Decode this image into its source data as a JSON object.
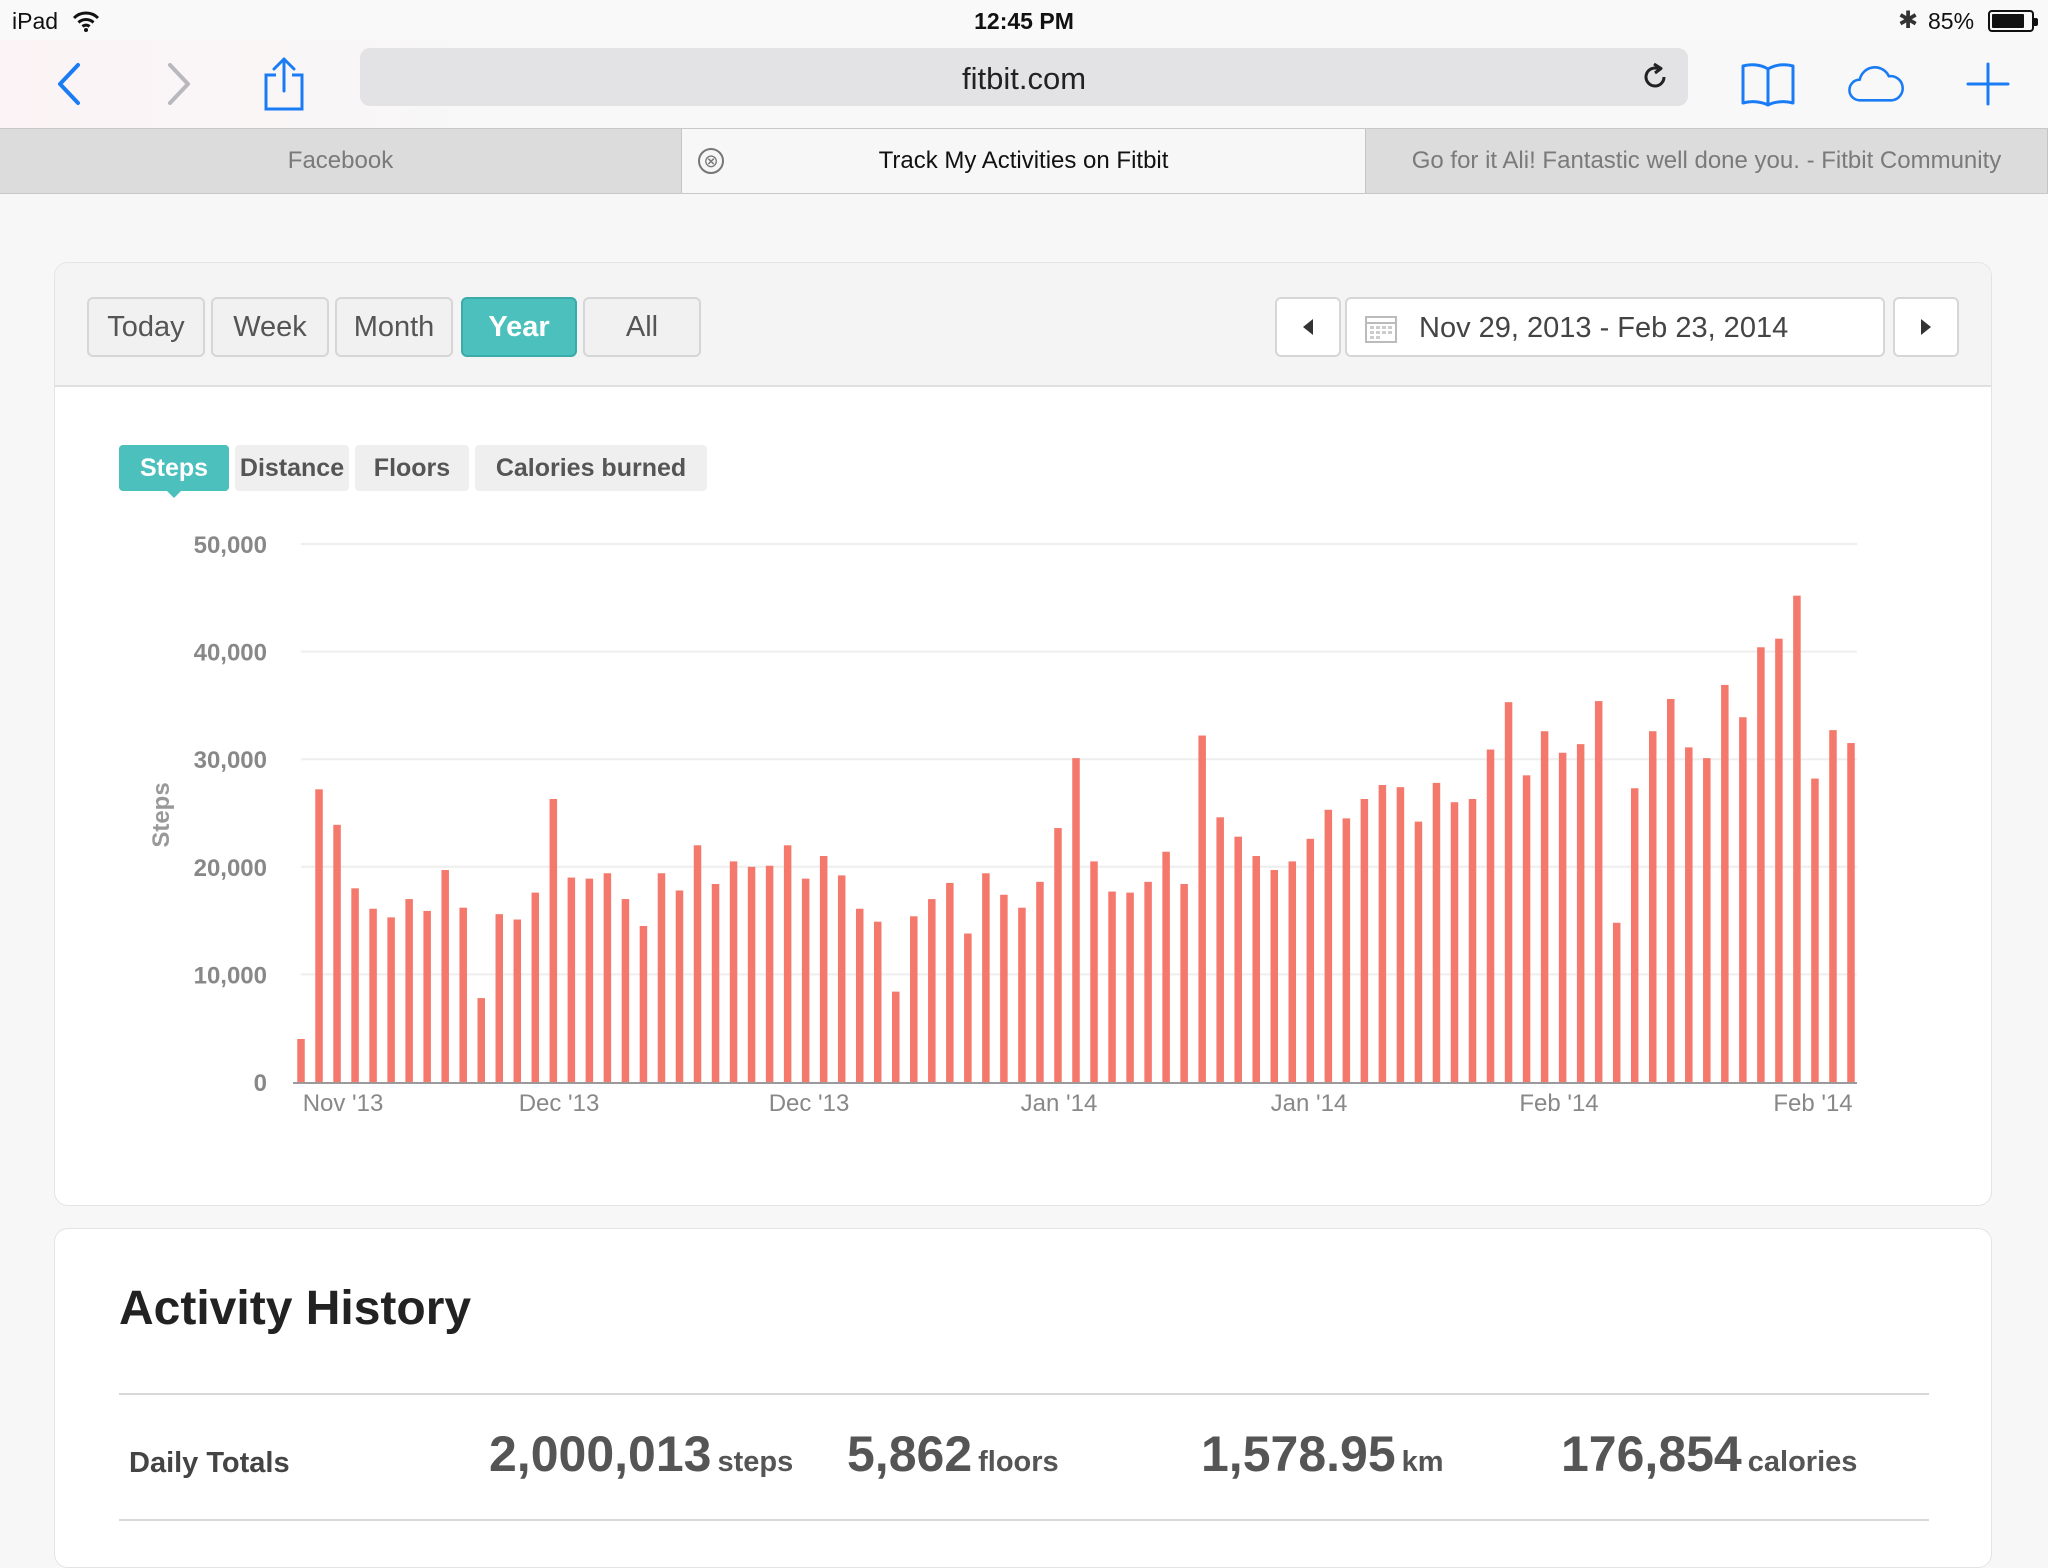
{
  "status": {
    "device": "iPad",
    "time": "12:45 PM",
    "battery_pct": "85%",
    "battery_level": 0.85
  },
  "toolbar": {
    "url": "fitbit.com",
    "icons": [
      "back-icon",
      "forward-icon",
      "share-icon",
      "reload-icon",
      "bookmarks-icon",
      "cloud-tabs-icon",
      "new-tab-icon"
    ]
  },
  "tabs": [
    {
      "label": "Facebook"
    },
    {
      "label": "Track My Activities on Fitbit",
      "close": "⊗"
    },
    {
      "label": "Go for it Ali! Fantastic well done you. - Fitbit Community"
    }
  ],
  "range": {
    "buttons": [
      "Today",
      "Week",
      "Month",
      "Year",
      "All"
    ],
    "active": "Year",
    "date_range": "Nov 29, 2013 - Feb 23, 2014"
  },
  "metric_tabs": {
    "items": [
      "Steps",
      "Distance",
      "Floors",
      "Calories burned"
    ],
    "active": "Steps"
  },
  "chart_data": {
    "type": "bar",
    "title": "",
    "xlabel": "",
    "ylabel": "Steps",
    "ylim": [
      0,
      50000
    ],
    "yticks": [
      0,
      10000,
      20000,
      30000,
      40000,
      50000
    ],
    "ytick_labels": [
      "0",
      "10,000",
      "20,000",
      "30,000",
      "40,000",
      "50,000"
    ],
    "xtick_labels": [
      "Nov '13",
      "Dec '13",
      "Dec '13",
      "Jan '14",
      "Jan '14",
      "Feb '14",
      "Feb '14"
    ],
    "grid": true,
    "color": "#f4786b",
    "values": [
      4000,
      27200,
      23900,
      18000,
      16100,
      15300,
      17000,
      15900,
      19700,
      16200,
      7800,
      15600,
      15100,
      17600,
      26300,
      19000,
      18900,
      19400,
      17000,
      14500,
      19400,
      17800,
      22000,
      18400,
      20500,
      20000,
      20100,
      22000,
      18900,
      21000,
      19200,
      16100,
      14900,
      8400,
      15400,
      17000,
      18500,
      13800,
      19400,
      17400,
      16200,
      18600,
      23600,
      30100,
      20500,
      17700,
      17600,
      18600,
      21400,
      18400,
      32200,
      24600,
      22800,
      21000,
      19700,
      20500,
      22600,
      25300,
      24500,
      26300,
      27600,
      27400,
      24200,
      27800,
      26000,
      26300,
      30900,
      35300,
      28500,
      32600,
      30600,
      31400,
      35400,
      14800,
      27300,
      32600,
      35600,
      31100,
      30100,
      36900,
      33900,
      40400,
      41200,
      45200,
      28200,
      32700,
      31500
    ]
  },
  "history": {
    "title": "Activity History",
    "totals_label": "Daily Totals",
    "stats": [
      {
        "value": "2,000,013",
        "unit": "steps"
      },
      {
        "value": "5,862",
        "unit": "floors"
      },
      {
        "value": "1,578.95",
        "unit": "km"
      },
      {
        "value": "176,854",
        "unit": "calories"
      }
    ]
  }
}
